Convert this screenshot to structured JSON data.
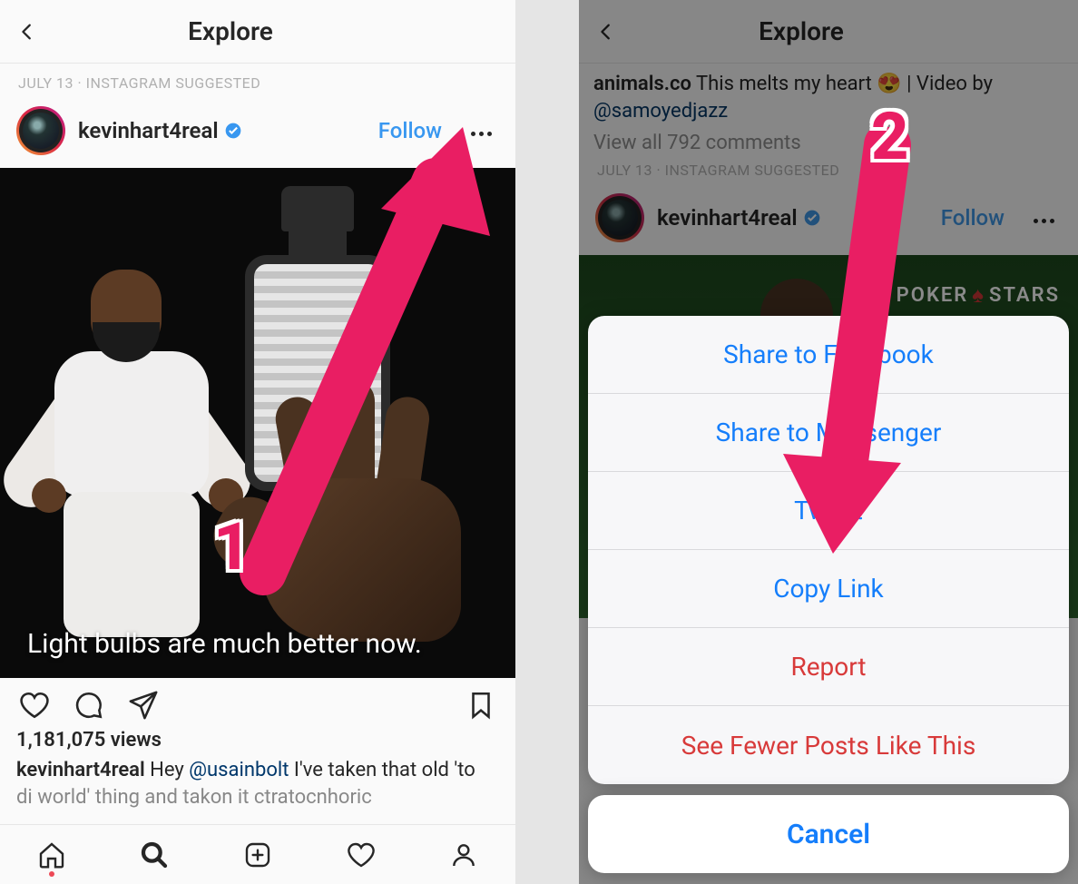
{
  "left": {
    "header_title": "Explore",
    "meta": "JULY 13 · INSTAGRAM SUGGESTED",
    "account": {
      "username": "kevinhart4real",
      "verified": true,
      "follow_label": "Follow"
    },
    "media_overlay_text": "Light bulbs are much better now.",
    "views_label": "1,181,075 views",
    "caption": {
      "username": "kevinhart4real",
      "text_1": " Hey ",
      "mention": "@usainbolt",
      "text_2": " I've taken that old 'to",
      "fade_line": "di world' thing and takon it ctratocnhoric"
    },
    "step_label": "1"
  },
  "right": {
    "header_title": "Explore",
    "comment": {
      "username": "animals.co",
      "text": " This melts my heart 😍 | Video by ",
      "mention": "@samoyedjazz"
    },
    "view_comments": "View all 792 comments",
    "meta": "JULY 13 · INSTAGRAM SUGGESTED",
    "account": {
      "username": "kevinhart4real",
      "verified": true,
      "follow_label": "Follow"
    },
    "pokerstars_left": "POKER",
    "pokerstars_right": "STARS",
    "sheet": {
      "items": [
        "Share to Facebook",
        "Share to Messenger",
        "Tweet",
        "Copy Link",
        "Report",
        "See Fewer Posts Like This"
      ],
      "cancel": "Cancel"
    },
    "step_label": "2"
  }
}
